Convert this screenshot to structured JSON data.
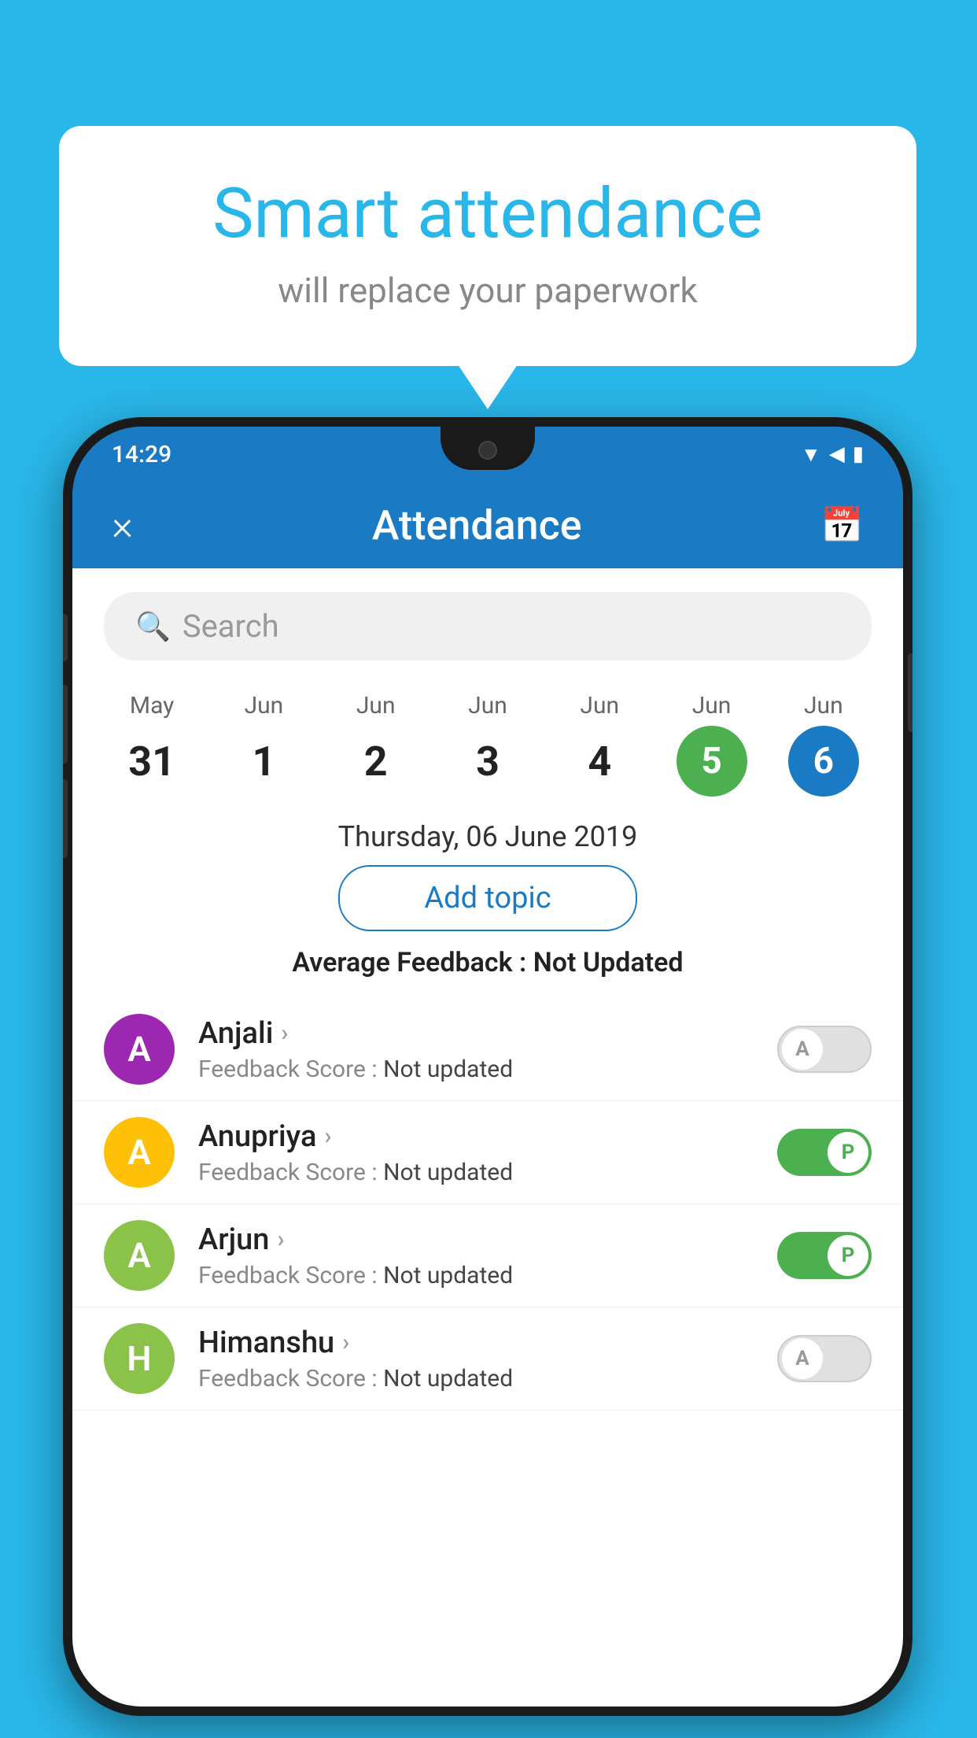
{
  "background_color": "#29B6E8",
  "speech_bubble": {
    "title": "Smart attendance",
    "subtitle": "will replace your paperwork"
  },
  "phone": {
    "time": "14:29",
    "header": {
      "title": "Attendance",
      "close_label": "×",
      "calendar_icon": "📅"
    },
    "search": {
      "placeholder": "Search"
    },
    "calendar": {
      "days": [
        {
          "month": "May",
          "date": "31",
          "style": "normal"
        },
        {
          "month": "Jun",
          "date": "1",
          "style": "normal"
        },
        {
          "month": "Jun",
          "date": "2",
          "style": "normal"
        },
        {
          "month": "Jun",
          "date": "3",
          "style": "normal"
        },
        {
          "month": "Jun",
          "date": "4",
          "style": "normal"
        },
        {
          "month": "Jun",
          "date": "5",
          "style": "today"
        },
        {
          "month": "Jun",
          "date": "6",
          "style": "selected"
        }
      ]
    },
    "selected_date": "Thursday, 06 June 2019",
    "add_topic_label": "Add topic",
    "avg_feedback_label": "Average Feedback :",
    "avg_feedback_value": "Not Updated",
    "students": [
      {
        "name": "Anjali",
        "avatar_letter": "A",
        "avatar_color": "#9C27B0",
        "feedback_label": "Feedback Score :",
        "feedback_value": "Not updated",
        "toggle": "off",
        "toggle_letter": "A"
      },
      {
        "name": "Anupriya",
        "avatar_letter": "A",
        "avatar_color": "#FFC107",
        "feedback_label": "Feedback Score :",
        "feedback_value": "Not updated",
        "toggle": "on",
        "toggle_letter": "P"
      },
      {
        "name": "Arjun",
        "avatar_letter": "A",
        "avatar_color": "#8BC34A",
        "feedback_label": "Feedback Score :",
        "feedback_value": "Not updated",
        "toggle": "on",
        "toggle_letter": "P"
      },
      {
        "name": "Himanshu",
        "avatar_letter": "H",
        "avatar_color": "#8BC34A",
        "feedback_label": "Feedback Score :",
        "feedback_value": "Not updated",
        "toggle": "off",
        "toggle_letter": "A"
      }
    ]
  }
}
